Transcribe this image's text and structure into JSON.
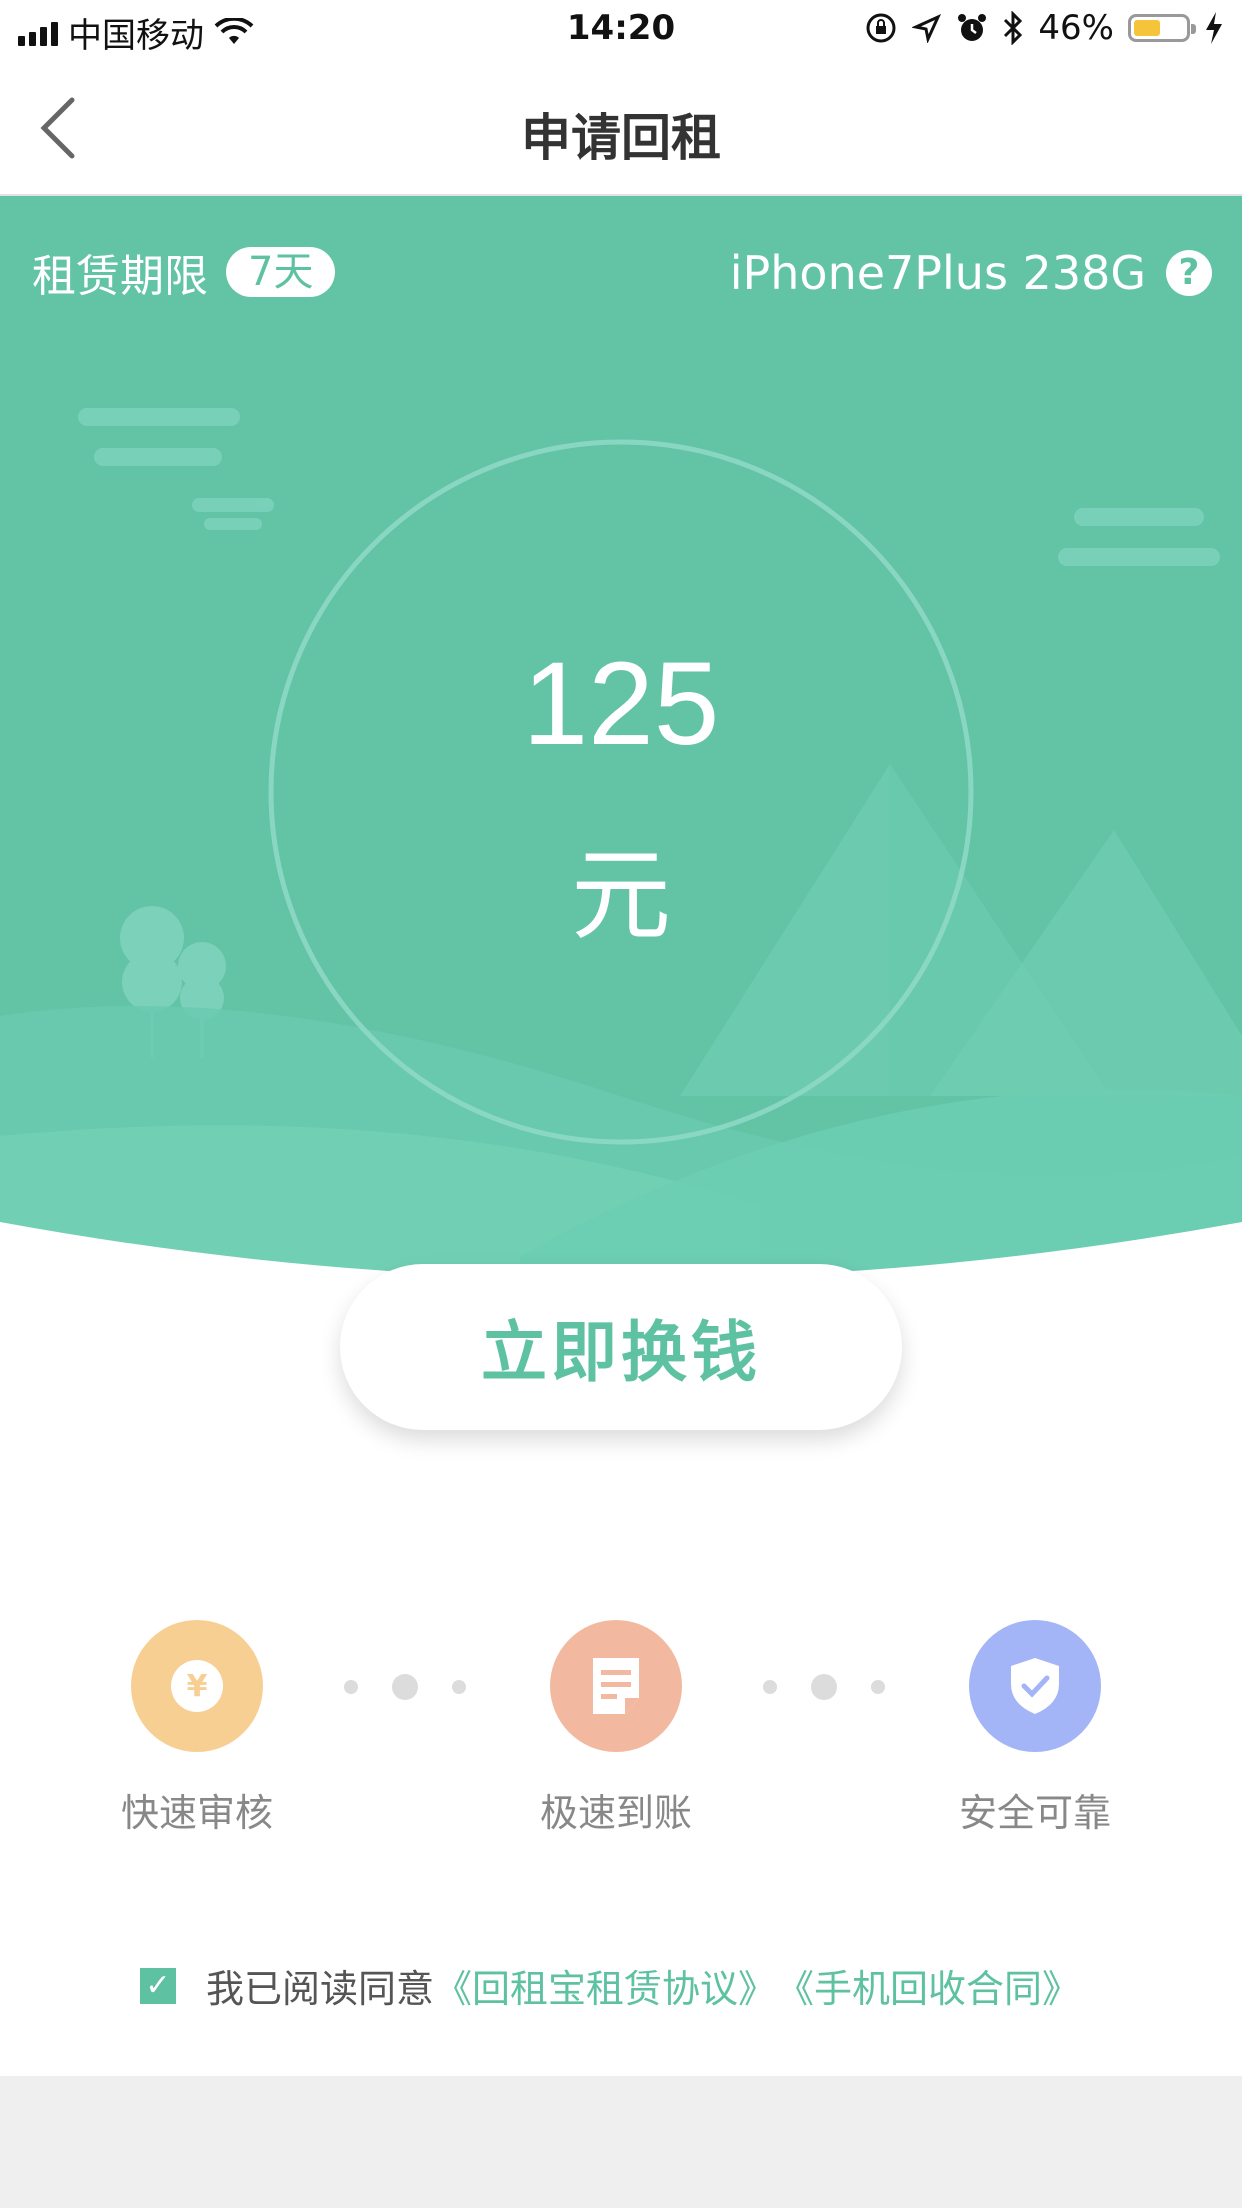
{
  "status_bar": {
    "carrier": "中国移动",
    "time": "14:20",
    "battery_percent": "46%"
  },
  "nav": {
    "title": "申请回租"
  },
  "hero": {
    "lease_label": "租赁期限",
    "lease_term": "7天",
    "device": "iPhone7Plus 238G",
    "help_symbol": "?",
    "amount": "125",
    "unit": "元",
    "cta_label": "立即换钱"
  },
  "features": [
    {
      "label": "快速审核",
      "icon": "yuan-coin-icon",
      "color": "#f7cf92",
      "symbol": "¥"
    },
    {
      "label": "极速到账",
      "icon": "document-icon",
      "color": "#f3b9a0"
    },
    {
      "label": "安全可靠",
      "icon": "shield-check-icon",
      "color": "#a3b5f6"
    }
  ],
  "agreement": {
    "checked_symbol": "✓",
    "prefix": "我已阅读同意",
    "link1": "《回租宝租赁协议》",
    "link2": "《手机回收合同》"
  },
  "colors": {
    "brand_green": "#5ec2a2",
    "hero_bg": "#62c3a5",
    "light_green": "#73d1b4"
  }
}
